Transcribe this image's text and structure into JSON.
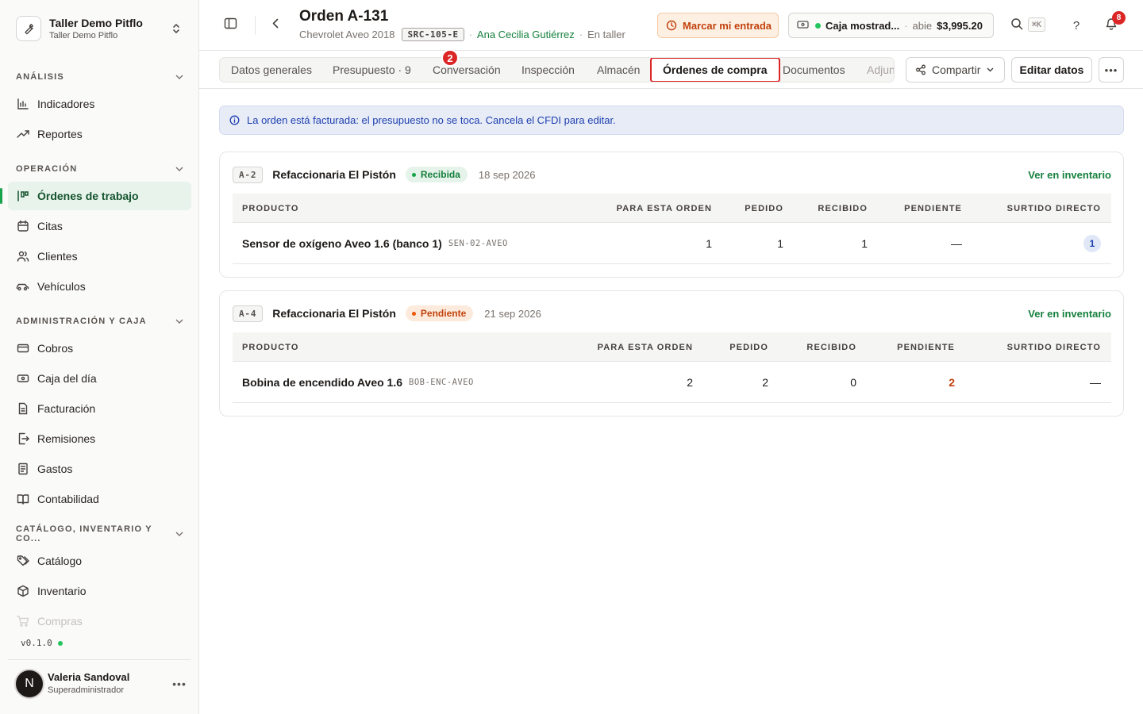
{
  "sidebar": {
    "tenant_name": "Taller Demo Pitflo",
    "tenant_sub": "Taller Demo Pitflo",
    "sections": {
      "analisis": "ANÁLISIS",
      "operacion": "OPERACIÓN",
      "admin": "ADMINISTRACIÓN Y CAJA",
      "catalogo": "CATÁLOGO, INVENTARIO Y CO..."
    },
    "items": {
      "indicadores": "Indicadores",
      "reportes": "Reportes",
      "ordenes": "Órdenes de trabajo",
      "citas": "Citas",
      "clientes": "Clientes",
      "vehiculos": "Vehículos",
      "cobros": "Cobros",
      "caja": "Caja del día",
      "facturacion": "Facturación",
      "remisiones": "Remisiones",
      "gastos": "Gastos",
      "contabilidad": "Contabilidad",
      "catalogo": "Catálogo",
      "inventario": "Inventario",
      "compras": "Compras"
    },
    "version": "v0.1.0",
    "user": {
      "initial": "N",
      "name": "Valeria Sandoval",
      "role": "Superadministrador"
    }
  },
  "header": {
    "title": "Orden A-131",
    "vehicle": "Chevrolet Aveo 2018",
    "plate": "SRC-105-E",
    "client": "Ana Cecilia Gutiérrez",
    "status": "En taller",
    "checkin_label": "Marcar mi entrada",
    "cashbox": {
      "name": "Caja mostrad...",
      "state": "abie",
      "amount": "$3,995.20"
    },
    "search_shortcut": "⌘K",
    "notifications_count": "8"
  },
  "tabs": {
    "datos": "Datos generales",
    "presupuesto": "Presupuesto · 9",
    "conversacion": "Conversación",
    "inspeccion": "Inspección",
    "almacen": "Almacén",
    "ordenes_compra": "Órdenes de compra",
    "documentos": "Documentos",
    "adjuntos": "Adjun",
    "marker": "2",
    "share_label": "Compartir",
    "edit_label": "Editar datos"
  },
  "alert": "La orden está facturada: el presupuesto no se toca. Cancela el CFDI para editar.",
  "columns": {
    "producto": "PRODUCTO",
    "para_orden": "PARA ESTA ORDEN",
    "pedido": "PEDIDO",
    "recibido": "RECIBIDO",
    "pendiente": "PENDIENTE",
    "surtido": "SURTIDO DIRECTO"
  },
  "purchase_orders": [
    {
      "code": "A-2",
      "supplier": "Refaccionaria El Pistón",
      "status": "Recibida",
      "date": "18 sep 2026",
      "link": "Ver en inventario",
      "row": {
        "product": "Sensor de oxígeno Aveo 1.6 (banco 1)",
        "sku": "SEN-02-AVEO",
        "para_orden": "1",
        "pedido": "1",
        "recibido": "1",
        "pendiente": "—",
        "surtido": "1"
      }
    },
    {
      "code": "A-4",
      "supplier": "Refaccionaria El Pistón",
      "status": "Pendiente",
      "date": "21 sep 2026",
      "link": "Ver en inventario",
      "row": {
        "product": "Bobina de encendido Aveo 1.6",
        "sku": "BOB-ENC-AVEO",
        "para_orden": "2",
        "pedido": "2",
        "recibido": "0",
        "pendiente": "2",
        "surtido": "—"
      }
    }
  ]
}
